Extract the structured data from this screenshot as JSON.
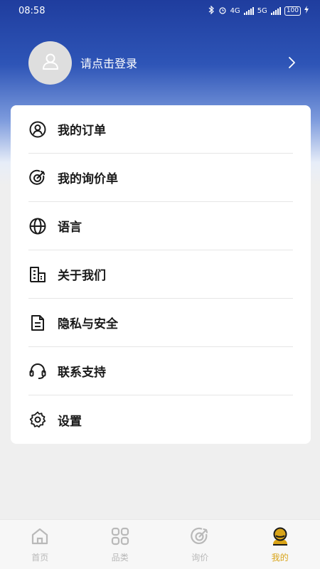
{
  "status_bar": {
    "time": "08:58",
    "network_labels": [
      "4G",
      "5G"
    ],
    "battery": "100"
  },
  "profile": {
    "login_prompt": "请点击登录"
  },
  "menu": [
    {
      "label": "我的订单",
      "icon": "user-circle-icon"
    },
    {
      "label": "我的询价单",
      "icon": "target-icon"
    },
    {
      "label": "语言",
      "icon": "globe-icon"
    },
    {
      "label": "关于我们",
      "icon": "building-icon"
    },
    {
      "label": "隐私与安全",
      "icon": "document-icon"
    },
    {
      "label": "联系支持",
      "icon": "headset-icon"
    },
    {
      "label": "设置",
      "icon": "gear-icon"
    }
  ],
  "tabbar": [
    {
      "label": "首页",
      "icon": "home-icon",
      "active": false
    },
    {
      "label": "品类",
      "icon": "category-grid-icon",
      "active": false
    },
    {
      "label": "询价",
      "icon": "target-icon",
      "active": false
    },
    {
      "label": "我的",
      "icon": "profile-icon",
      "active": true
    }
  ],
  "colors": {
    "header_gradient_top": "#1f3d9e",
    "accent_active_tab": "#d9a418",
    "inactive_tab": "#b9b9b9",
    "background": "#efefef"
  }
}
